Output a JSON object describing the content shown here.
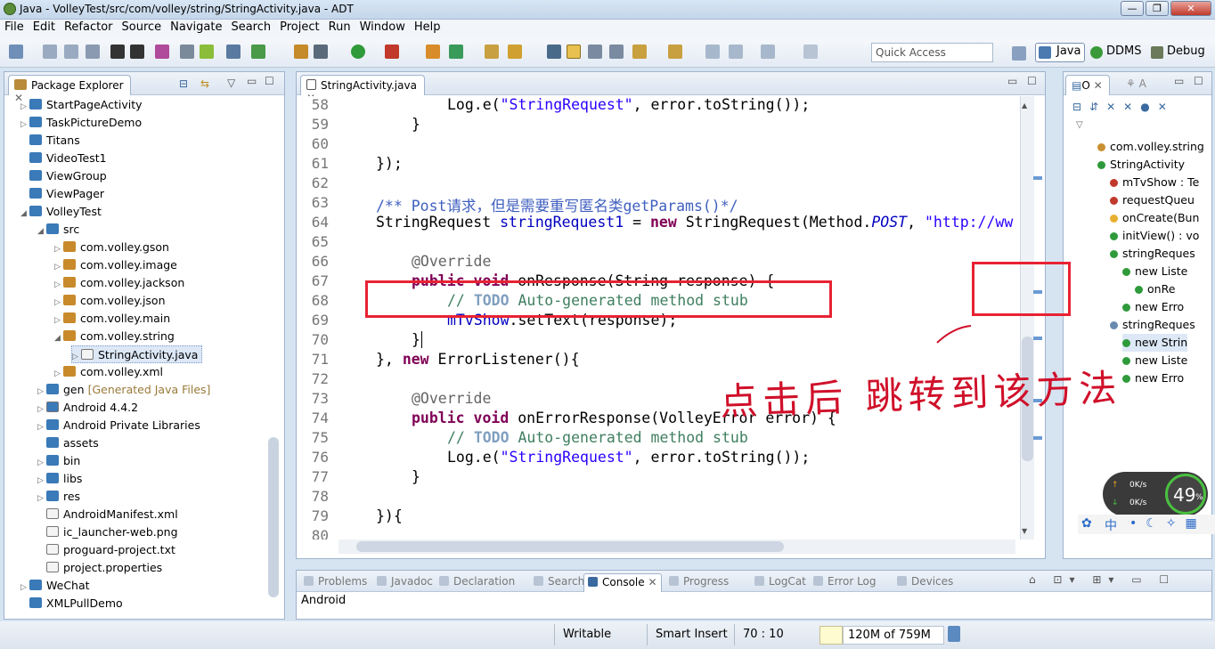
{
  "window": {
    "title": "Java - VolleyTest/src/com/volley/string/StringActivity.java - ADT"
  },
  "menu": [
    "File",
    "Edit",
    "Refactor",
    "Source",
    "Navigate",
    "Search",
    "Project",
    "Run",
    "Window",
    "Help"
  ],
  "toolbar": {
    "quick_access_placeholder": "Quick Access"
  },
  "perspectives": [
    "Java",
    "DDMS",
    "Debug"
  ],
  "package_explorer": {
    "title": "Package Explorer",
    "items": [
      {
        "label": "StartPageActivity",
        "indent": 0,
        "arrow": "▷"
      },
      {
        "label": "TaskPictureDemo",
        "indent": 0,
        "arrow": "▷"
      },
      {
        "label": "Titans",
        "indent": 0,
        "arrow": ""
      },
      {
        "label": "VideoTest1",
        "indent": 0,
        "arrow": ""
      },
      {
        "label": "ViewGroup",
        "indent": 0,
        "arrow": ""
      },
      {
        "label": "ViewPager",
        "indent": 0,
        "arrow": ""
      },
      {
        "label": "VolleyTest",
        "indent": 0,
        "arrow": "◢"
      },
      {
        "label": "src",
        "indent": 1,
        "arrow": "◢"
      },
      {
        "label": "com.volley.gson",
        "indent": 2,
        "arrow": "▷"
      },
      {
        "label": "com.volley.image",
        "indent": 2,
        "arrow": "▷"
      },
      {
        "label": "com.volley.jackson",
        "indent": 2,
        "arrow": "▷"
      },
      {
        "label": "com.volley.json",
        "indent": 2,
        "arrow": "▷"
      },
      {
        "label": "com.volley.main",
        "indent": 2,
        "arrow": "▷"
      },
      {
        "label": "com.volley.string",
        "indent": 2,
        "arrow": "◢"
      },
      {
        "label": "StringActivity.java",
        "indent": 3,
        "arrow": "▷"
      },
      {
        "label": "com.volley.xml",
        "indent": 2,
        "arrow": "▷"
      },
      {
        "label": "gen",
        "indent": 1,
        "arrow": "▷",
        "suffix": "[Generated Java Files]"
      },
      {
        "label": "Android 4.4.2",
        "indent": 1,
        "arrow": "▷"
      },
      {
        "label": "Android Private Libraries",
        "indent": 1,
        "arrow": "▷"
      },
      {
        "label": "assets",
        "indent": 1,
        "arrow": ""
      },
      {
        "label": "bin",
        "indent": 1,
        "arrow": "▷"
      },
      {
        "label": "libs",
        "indent": 1,
        "arrow": "▷"
      },
      {
        "label": "res",
        "indent": 1,
        "arrow": "▷"
      },
      {
        "label": "AndroidManifest.xml",
        "indent": 1,
        "arrow": ""
      },
      {
        "label": "ic_launcher-web.png",
        "indent": 1,
        "arrow": ""
      },
      {
        "label": "proguard-project.txt",
        "indent": 1,
        "arrow": ""
      },
      {
        "label": "project.properties",
        "indent": 1,
        "arrow": ""
      },
      {
        "label": "WeChat",
        "indent": 0,
        "arrow": "▷"
      },
      {
        "label": "XMLPullDemo",
        "indent": 0,
        "arrow": ""
      }
    ]
  },
  "editor": {
    "tab": "StringActivity.java",
    "line_numbers": [
      "58",
      "59",
      "60",
      "61",
      "62",
      "63",
      "64",
      "65",
      "66",
      "67",
      "68",
      "69",
      "70",
      "71",
      "72",
      "73",
      "74",
      "75",
      "76",
      "77",
      "78",
      "79",
      "80"
    ]
  },
  "outline": {
    "tab": "O",
    "tab2": "A",
    "items": [
      "com.volley.string",
      "StringActivity",
      "mTvShow : Te",
      "requestQueu",
      "onCreate(Bun",
      "initView() : vo",
      "stringReques",
      "new Liste",
      "onRe",
      "new Erro",
      "stringReques",
      "new Strin",
      "new Liste",
      "new Erro"
    ]
  },
  "bottom_tabs": [
    "Problems",
    "Javadoc",
    "Declaration",
    "Search",
    "Console",
    "Progress",
    "LogCat",
    "Error Log",
    "Devices"
  ],
  "console": {
    "label": "Android"
  },
  "status": {
    "writable": "Writable",
    "insert": "Smart Insert",
    "position": "70 : 10",
    "memory": "120M of 759M"
  },
  "net_widget": {
    "up": "0K/s",
    "down": "0K/s",
    "percent": "49",
    "percent_sign": "%"
  },
  "ime": {
    "lang": "中"
  },
  "annotation": {
    "text": "点击后 跳转到该方法"
  }
}
